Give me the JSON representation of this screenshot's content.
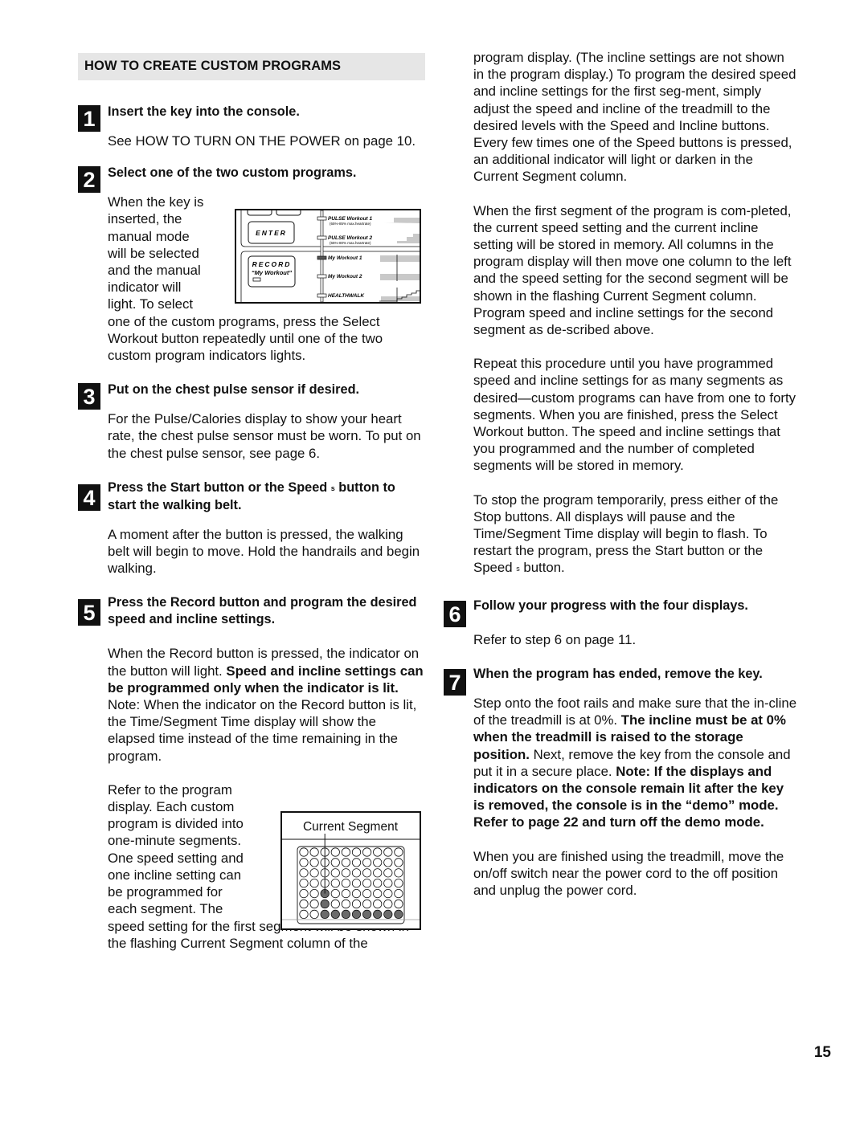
{
  "section_title": "HOW TO CREATE CUSTOM PROGRAMS",
  "steps": [
    {
      "num": "1",
      "heading": "Insert the key into the console.",
      "body": "See HOW TO TURN ON THE POWER on page 10."
    },
    {
      "num": "2",
      "heading": "Select one of the two custom programs.",
      "body_wrap": [
        "When the key is",
        "inserted, the",
        "manual mode",
        "will be selected",
        "and the manual",
        "indicator will",
        "light. To select"
      ],
      "body_rest": "one of the custom programs, press the Select Workout button repeatedly until one of the two custom program indicators lights."
    },
    {
      "num": "3",
      "heading": "Put on the chest pulse sensor if desired.",
      "body": "For the Pulse/Calories display to show your heart rate, the chest pulse sensor must be worn. To put on the chest pulse sensor, see page 6."
    },
    {
      "num": "4",
      "heading_a": "Press the Start button or the Speed",
      "heading_sym": "s",
      "heading_b": "button to start the walking belt.",
      "body": "A moment after the button is pressed, the walking belt will begin to move. Hold the handrails and begin walking."
    },
    {
      "num": "5",
      "heading": "Press the Record button and program the desired speed and incline settings.",
      "body_a": "When the Record button is pressed, the indicator on the button will light.",
      "body_bold": "Speed and incline settings can be programmed only when the indicator is lit.",
      "body_b": "Note: When the indicator on the Record button is lit, the Time/Segment Time display will show the elapsed time instead of the time remaining in the program.",
      "body2_wrap": [
        "Refer to the program",
        "display. Each custom",
        "program is divided into",
        "one-minute segments.",
        "One speed setting and",
        "one incline setting can",
        "be programmed for",
        "each segment. The"
      ],
      "body2_rest": "speed setting for the first segment will be shown in the flashing Current Segment column of the",
      "cont1": "program display. (The incline settings are not shown in the program display.) To program the desired speed and incline settings for the first seg-ment, simply adjust the speed and incline of the treadmill to the desired levels with the Speed and Incline buttons. Every few times one of the Speed buttons is pressed, an additional indicator will light or darken in the Current Segment column.",
      "cont2": "When the first segment of the program is com-pleted, the current speed setting and the current incline setting will be stored in memory. All columns in the program display will then move one column to the left and the speed setting for the second segment will be shown in the flashing Current Segment column. Program speed and incline settings for the second segment as de-scribed above.",
      "cont3": "Repeat this procedure until you have programmed speed and incline settings for as many segments as desired—custom programs can have from one to forty segments. When you are finished, press the Select Workout button. The speed and incline settings that you programmed and the number of completed segments will be stored in memory.",
      "cont4_a": "To stop the program temporarily, press either of the Stop buttons. All displays will pause and the Time/Segment Time display will begin to flash. To restart the program, press the Start button or the Speed",
      "cont4_sym": "s",
      "cont4_b": "button."
    },
    {
      "num": "6",
      "heading": "Follow your progress with the four displays.",
      "body": "Refer to step 6 on page 11."
    },
    {
      "num": "7",
      "heading": "When the program has ended, remove the key.",
      "body_a": "Step onto the foot rails and make sure that the in-cline of the treadmill is at 0%.",
      "body_bold1": "The incline must be at 0% when the treadmill is raised to the storage position.",
      "body_b": "Next, remove the key from the console and put it in a secure place.",
      "body_bold2": "Note: If the displays and indicators on the console remain lit after the key is removed, the console is in the “demo” mode. Refer to page 22 and turn off the demo mode.",
      "body2": "When you are finished using the treadmill, move the on/off switch near the power cord to the off position and unplug the power cord."
    }
  ],
  "console_figure": {
    "enter_label": "ENTER",
    "record_label": "RECORD",
    "record_sub": "“My Workout”",
    "programs": [
      {
        "name": "PULSE Workout 1",
        "sub": "(65%-85% max.heartrate)",
        "active": false
      },
      {
        "name": "PULSE Workout 2",
        "sub": "(65%-80% max.heartrate)",
        "active": false
      },
      {
        "name": "My Workout 1",
        "sub": "",
        "active": true
      },
      {
        "name": "My Workout 2",
        "sub": "",
        "active": false
      },
      {
        "name": "HEALTHWALK",
        "sub": "",
        "active": false
      }
    ]
  },
  "segment_figure": {
    "title": "Current Segment",
    "cols": 10,
    "rows": 7,
    "current_col": 3,
    "column_levels": [
      1,
      1,
      3,
      1,
      1,
      1,
      1,
      1,
      1,
      1
    ],
    "first_filled_bottom_col": 3
  },
  "page_number": "15"
}
